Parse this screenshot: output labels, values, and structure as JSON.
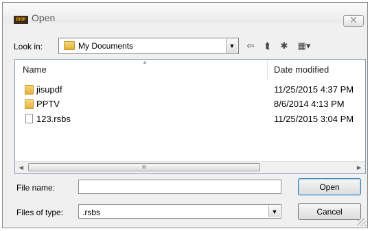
{
  "window": {
    "title": "Open",
    "app_icon_text": "BISP",
    "close_glyph": "⨉"
  },
  "lookin": {
    "label": "Look in:",
    "value": "My Documents"
  },
  "toolbar": {
    "back_glyph": "⇦",
    "up_glyph": "⮬",
    "newfolder_glyph": "✱",
    "views_glyph": "▦▾"
  },
  "filelist": {
    "headers": {
      "name": "Name",
      "date": "Date modified"
    },
    "rows": [
      {
        "name": "jisupdf",
        "date": "11/25/2015 4:37 PM",
        "type": "folder"
      },
      {
        "name": "PPTV",
        "date": "8/6/2014 4:13 PM",
        "type": "folder"
      },
      {
        "name": "123.rsbs",
        "date": "11/25/2015 3:04 PM",
        "type": "file"
      }
    ],
    "scroll_thumb_grip": "III"
  },
  "filename": {
    "label": "File name:",
    "value": ""
  },
  "filetype": {
    "label": "Files of type:",
    "value": ".rsbs"
  },
  "buttons": {
    "open": "Open",
    "cancel": "Cancel"
  }
}
